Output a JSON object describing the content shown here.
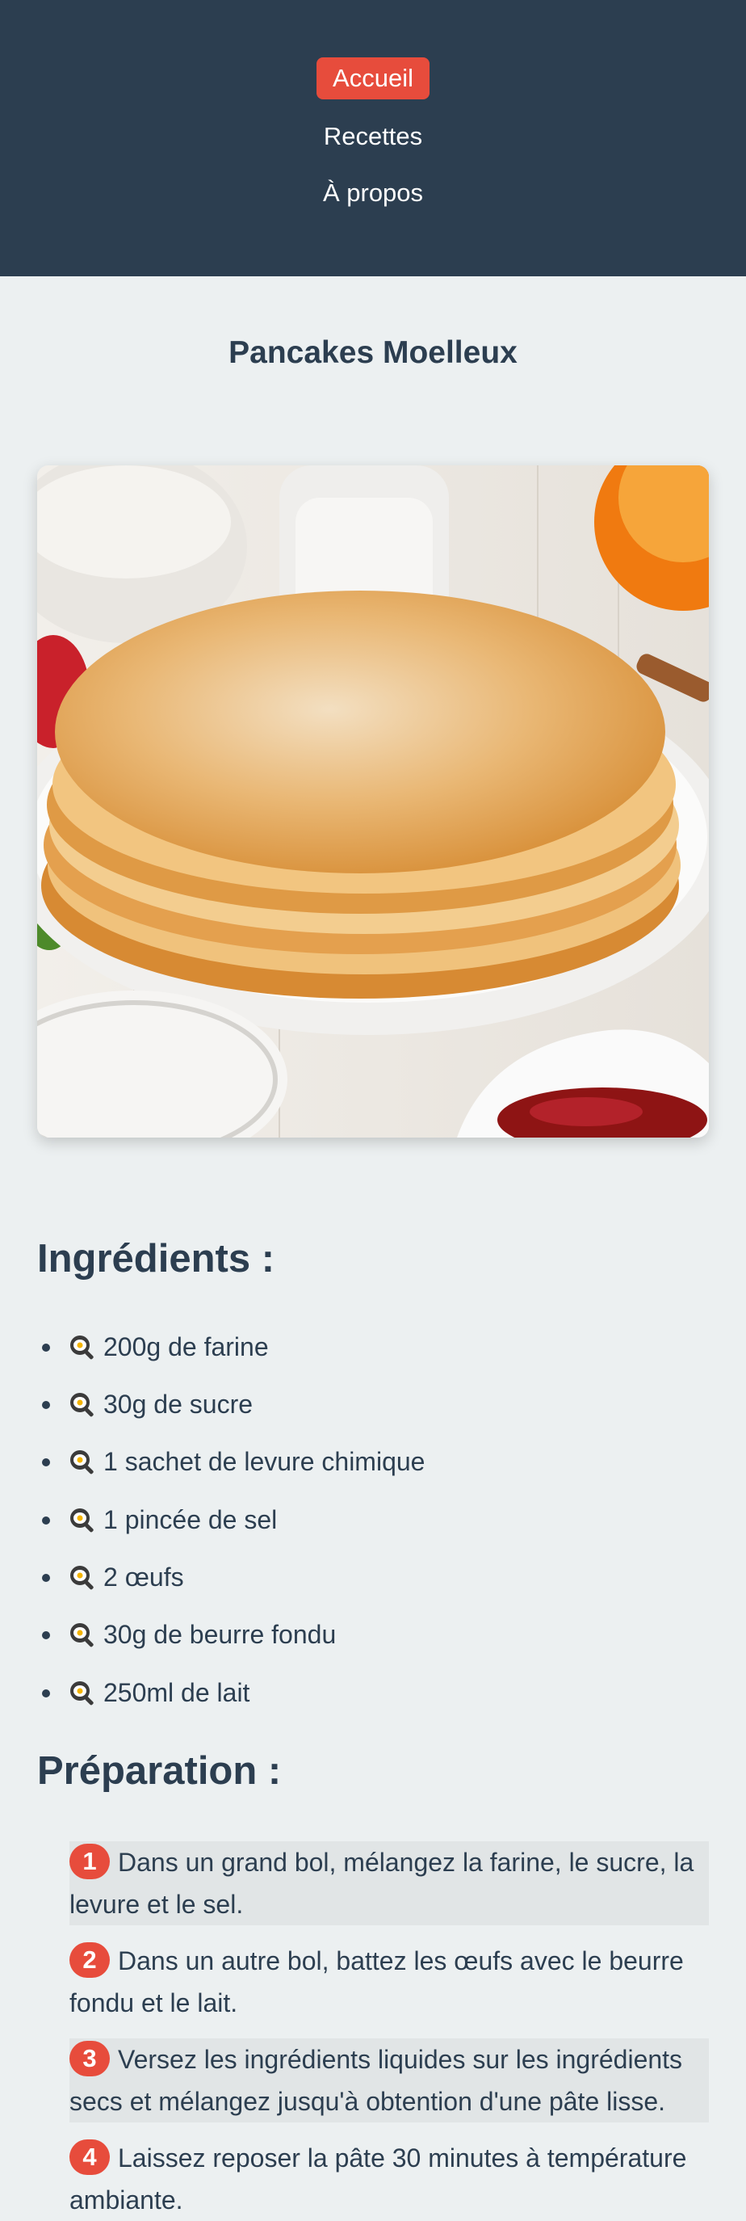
{
  "nav": {
    "home": "Accueil",
    "recipes": "Recettes",
    "about": "À propos"
  },
  "page": {
    "title": "Pancakes Moelleux"
  },
  "ingredients": {
    "title": "Ingrédients :",
    "icon": "frying-pan-egg-icon",
    "items": [
      "200g de farine",
      "30g de sucre",
      "1 sachet de levure chimique",
      "1 pincée de sel",
      "2 œufs",
      "30g de beurre fondu",
      "250ml de lait"
    ]
  },
  "preparation": {
    "title": "Préparation :",
    "steps": [
      {
        "num": "1",
        "text": "Dans un grand bol, mélangez la farine, le sucre, la levure et le sel."
      },
      {
        "num": "2",
        "text": "Dans un autre bol, battez les œufs avec le beurre fondu et le lait."
      },
      {
        "num": "3",
        "text": "Versez les ingrédients liquides sur les ingrédients secs et mélangez jusqu'à obtention d'une pâte lisse."
      },
      {
        "num": "4",
        "text": "Laissez reposer la pâte 30 minutes à température ambiante."
      }
    ]
  },
  "colors": {
    "header_bg": "#2c3e50",
    "accent": "#e74c3c",
    "page_bg": "#ecf0f1",
    "text": "#2c3e50"
  }
}
